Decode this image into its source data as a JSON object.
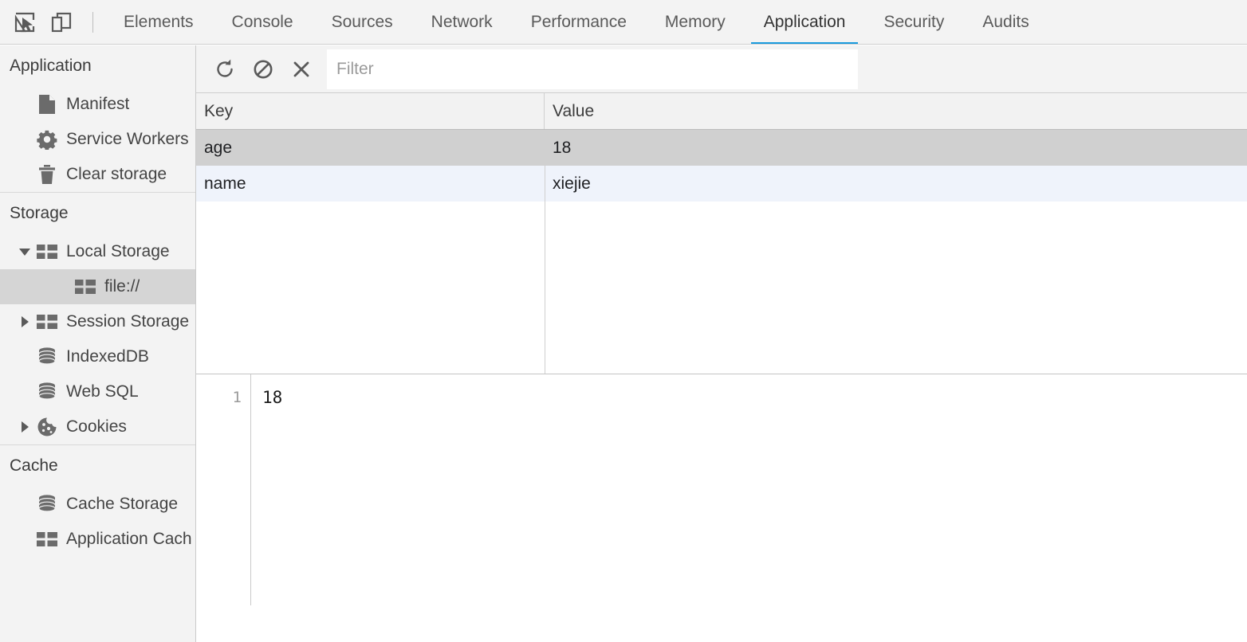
{
  "tabbar": {
    "inspect_icon": "inspect-cursor-icon",
    "device_icon": "device-toolbar-icon",
    "tabs": [
      {
        "label": "Elements",
        "active": false
      },
      {
        "label": "Console",
        "active": false
      },
      {
        "label": "Sources",
        "active": false
      },
      {
        "label": "Network",
        "active": false
      },
      {
        "label": "Performance",
        "active": false
      },
      {
        "label": "Memory",
        "active": false
      },
      {
        "label": "Application",
        "active": true
      },
      {
        "label": "Security",
        "active": false
      },
      {
        "label": "Audits",
        "active": false
      }
    ],
    "active_tab": "Application",
    "accent_color": "#1a9bde"
  },
  "sidebar": {
    "sections": [
      {
        "title": "Application",
        "items": [
          {
            "label": "Manifest",
            "icon": "document-icon",
            "arrow": "none",
            "selected": false,
            "level": 1
          },
          {
            "label": "Service Workers",
            "icon": "gear-icon",
            "arrow": "none",
            "selected": false,
            "level": 1
          },
          {
            "label": "Clear storage",
            "icon": "trash-icon",
            "arrow": "none",
            "selected": false,
            "level": 1
          }
        ]
      },
      {
        "title": "Storage",
        "items": [
          {
            "label": "Local Storage",
            "icon": "table-grid-icon",
            "arrow": "expanded",
            "selected": false,
            "level": 1
          },
          {
            "label": "file://",
            "icon": "table-grid-icon",
            "arrow": "none",
            "selected": true,
            "level": 2
          },
          {
            "label": "Session Storage",
            "icon": "table-grid-icon",
            "arrow": "collapsed",
            "selected": false,
            "level": 1
          },
          {
            "label": "IndexedDB",
            "icon": "database-icon",
            "arrow": "none",
            "selected": false,
            "level": 1
          },
          {
            "label": "Web SQL",
            "icon": "database-icon",
            "arrow": "none",
            "selected": false,
            "level": 1
          },
          {
            "label": "Cookies",
            "icon": "cookie-icon",
            "arrow": "collapsed",
            "selected": false,
            "level": 1
          }
        ]
      },
      {
        "title": "Cache",
        "items": [
          {
            "label": "Cache Storage",
            "icon": "database-icon",
            "arrow": "none",
            "selected": false,
            "level": 1
          },
          {
            "label": "Application Cache",
            "icon": "table-grid-icon",
            "arrow": "none",
            "selected": false,
            "level": 1
          }
        ]
      }
    ]
  },
  "toolbar": {
    "refresh_icon": "refresh-icon",
    "clear_icon": "clear-all-icon",
    "delete_icon": "delete-selected-icon",
    "filter_placeholder": "Filter",
    "filter_value": ""
  },
  "grid": {
    "columns": [
      "Key",
      "Value"
    ],
    "rows": [
      {
        "key": "age",
        "value": "18",
        "selected": true
      },
      {
        "key": "name",
        "value": "xiejie",
        "selected": false
      }
    ]
  },
  "preview": {
    "line_numbers": [
      "1"
    ],
    "lines": [
      "18"
    ]
  }
}
